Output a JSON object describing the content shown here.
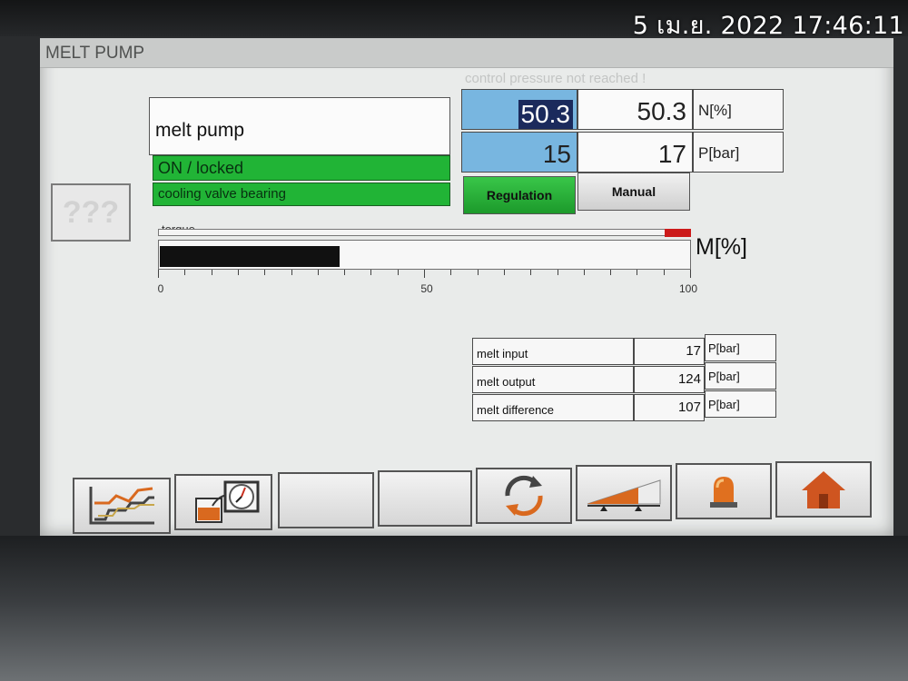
{
  "photo_timestamp": "5 เม.ย. 2022 17:46:11",
  "screen": {
    "title": "MELT PUMP",
    "status_message": "control pressure not reached !",
    "unknown_button_label": "???"
  },
  "status_panel": {
    "name": "melt pump",
    "state": "ON / locked",
    "info": "cooling valve bearing",
    "state_color": "#21b436"
  },
  "setpoints": {
    "speed": {
      "set": "50.3",
      "actual": "50.3",
      "unit": "N[%]"
    },
    "pressure": {
      "set": "15",
      "actual": "17",
      "unit": "P[bar]"
    }
  },
  "mode_buttons": {
    "regulation": "Regulation",
    "manual": "Manual",
    "active": "regulation"
  },
  "torque": {
    "label": "torque",
    "unit": "M[%]",
    "value_percent": 34,
    "limit_color": "#cc1a1a",
    "ticks": [
      "0",
      "50",
      "100"
    ]
  },
  "melt_table": [
    {
      "label": "melt input",
      "value": "17",
      "unit": "P[bar]"
    },
    {
      "label": "melt output",
      "value": "124",
      "unit": "P[bar]"
    },
    {
      "label": "melt difference",
      "value": "107",
      "unit": "P[bar]"
    }
  ],
  "nav_icons": [
    "trend-chart-icon",
    "tank-gauge-icon",
    "",
    "",
    "rotate-icon",
    "ramp-icon",
    "alarm-beacon-icon",
    "home-icon"
  ]
}
